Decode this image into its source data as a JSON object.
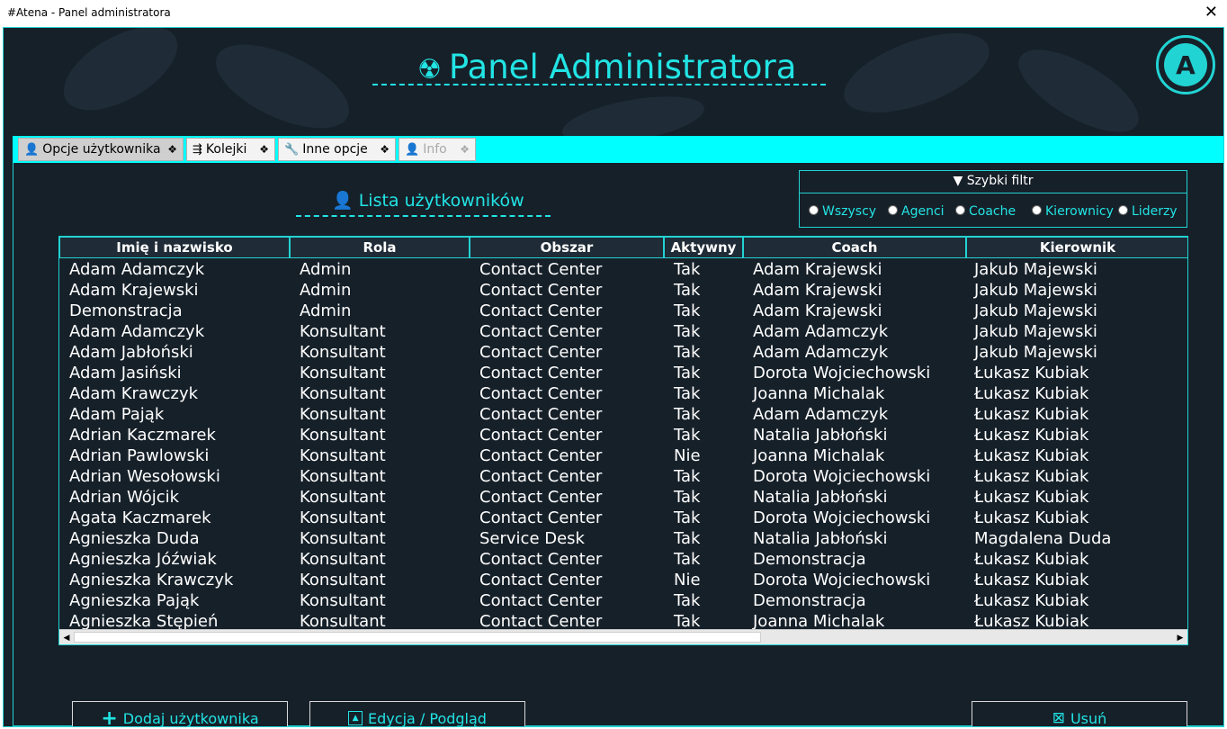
{
  "window": {
    "title": "#Atena - Panel administratora",
    "close_glyph": "✕"
  },
  "header": {
    "title": "Panel Administratora",
    "icon": "radiation-icon",
    "logo_letter": "A"
  },
  "tabs": [
    {
      "label": "Opcje użytkownika",
      "icon": "person-icon",
      "active": true,
      "enabled": true
    },
    {
      "label": "Kolejki",
      "icon": "queue-icon",
      "active": false,
      "enabled": true
    },
    {
      "label": "Inne opcje",
      "icon": "wrench-icon",
      "active": false,
      "enabled": true
    },
    {
      "label": "Info",
      "icon": "info-person-icon",
      "active": false,
      "enabled": false
    }
  ],
  "list": {
    "title": "Lista użytkowników"
  },
  "filter": {
    "title": "▼ Szybki filtr",
    "options": [
      "Wszyscy",
      "Agenci",
      "Coache",
      "Kierownicy",
      "Liderzy"
    ]
  },
  "table": {
    "columns": [
      "Imię i nazwisko",
      "Rola",
      "Obszar",
      "Aktywny",
      "Coach",
      "Kierownik"
    ],
    "rows": [
      [
        "Adam Adamczyk",
        "Admin",
        "Contact Center",
        "Tak",
        "Adam Krajewski",
        "Jakub Majewski"
      ],
      [
        "Adam Krajewski",
        "Admin",
        "Contact Center",
        "Tak",
        "Adam Krajewski",
        "Jakub Majewski"
      ],
      [
        "Demonstracja",
        "Admin",
        "Contact Center",
        "Tak",
        "Adam Krajewski",
        "Jakub Majewski"
      ],
      [
        "Adam Adamczyk",
        "Konsultant",
        "Contact Center",
        "Tak",
        "Adam Adamczyk",
        "Jakub Majewski"
      ],
      [
        "Adam Jabłoński",
        "Konsultant",
        "Contact Center",
        "Tak",
        "Adam Adamczyk",
        "Jakub Majewski"
      ],
      [
        "Adam Jasiński",
        "Konsultant",
        "Contact Center",
        "Tak",
        "Dorota Wojciechowski",
        "Łukasz Kubiak"
      ],
      [
        "Adam Krawczyk",
        "Konsultant",
        "Contact Center",
        "Tak",
        "Joanna Michalak",
        "Łukasz Kubiak"
      ],
      [
        "Adam Pająk",
        "Konsultant",
        "Contact Center",
        "Tak",
        "Adam Adamczyk",
        "Łukasz Kubiak"
      ],
      [
        "Adrian Kaczmarek",
        "Konsultant",
        "Contact Center",
        "Tak",
        "Natalia Jabłoński",
        "Łukasz Kubiak"
      ],
      [
        "Adrian Pawlowski",
        "Konsultant",
        "Contact Center",
        "Nie",
        "Joanna Michalak",
        "Łukasz Kubiak"
      ],
      [
        "Adrian Wesołowski",
        "Konsultant",
        "Contact Center",
        "Tak",
        "Dorota Wojciechowski",
        "Łukasz Kubiak"
      ],
      [
        "Adrian Wójcik",
        "Konsultant",
        "Contact Center",
        "Tak",
        "Natalia Jabłoński",
        "Łukasz Kubiak"
      ],
      [
        "Agata Kaczmarek",
        "Konsultant",
        "Contact Center",
        "Tak",
        "Dorota Wojciechowski",
        "Łukasz Kubiak"
      ],
      [
        "Agnieszka Duda",
        "Konsultant",
        "Service Desk",
        "Tak",
        "Natalia Jabłoński",
        "Magdalena Duda"
      ],
      [
        "Agnieszka Jóźwiak",
        "Konsultant",
        "Contact Center",
        "Tak",
        "Demonstracja",
        "Łukasz Kubiak"
      ],
      [
        "Agnieszka Krawczyk",
        "Konsultant",
        "Contact Center",
        "Nie",
        "Dorota Wojciechowski",
        "Łukasz Kubiak"
      ],
      [
        "Agnieszka Pająk",
        "Konsultant",
        "Contact Center",
        "Tak",
        "Demonstracja",
        "Łukasz Kubiak"
      ],
      [
        "Agnieszka Stępień",
        "Konsultant",
        "Contact Center",
        "Tak",
        "Joanna Michalak",
        "Łukasz Kubiak"
      ]
    ]
  },
  "buttons": {
    "add": "Dodaj użytkownika",
    "edit": "Edycja / Podgląd",
    "delete": "Usuń"
  },
  "colors": {
    "accent": "#22e4e4",
    "background": "#162029",
    "tabstrip": "#00ffff"
  }
}
